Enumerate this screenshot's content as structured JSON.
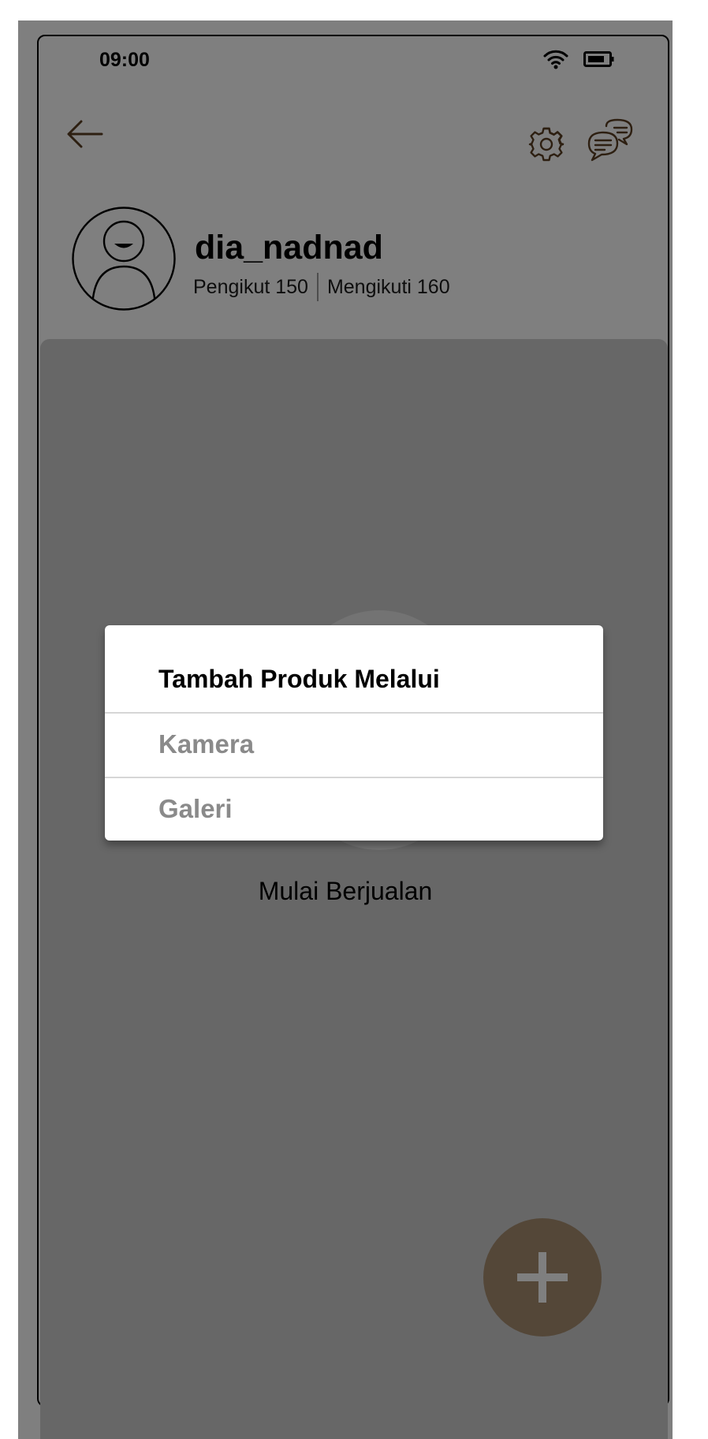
{
  "status_bar": {
    "time": "09:00"
  },
  "header": {
    "back_icon": "arrow-left-icon",
    "settings_icon": "gear-icon",
    "chat_icon": "chat-bubbles-icon"
  },
  "profile": {
    "username": "dia_nadnad",
    "followers": "Pengikut 150",
    "following": "Mengikuti 160"
  },
  "empty_state": {
    "caption": "Mulai Berjualan"
  },
  "fab": {
    "icon": "plus-icon"
  },
  "dialog": {
    "title": "Tambah Produk Melalui",
    "options": [
      {
        "label": "Kamera"
      },
      {
        "label": "Galeri"
      }
    ]
  },
  "colors": {
    "accent": "#a88e71",
    "icon_brown": "#5a3e22",
    "overlay": "#000000",
    "panel": "#cfcfcf"
  }
}
